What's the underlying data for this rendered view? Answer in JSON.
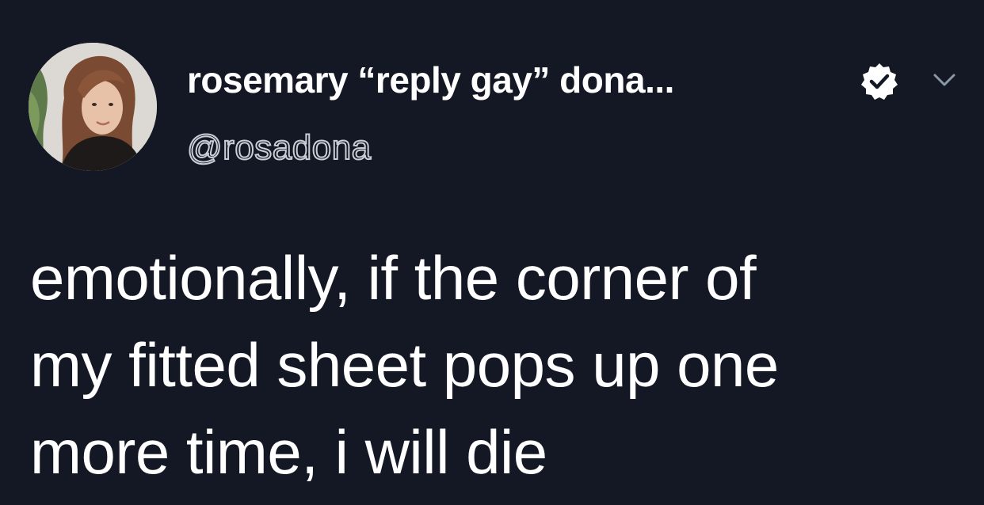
{
  "tweet": {
    "display_name": "rosemary “reply gay” dona...",
    "handle": "@rosadona",
    "text_lines": [
      "emotionally, if the corner of",
      "my fitted sheet pops up one",
      "more time, i will die"
    ]
  },
  "icons": {
    "avatar": "profile-photo",
    "verified": "verified-badge-icon",
    "menu": "chevron-down-icon"
  },
  "colors": {
    "background": "#141824",
    "text": "#ffffff",
    "muted": "#8b98a5"
  }
}
